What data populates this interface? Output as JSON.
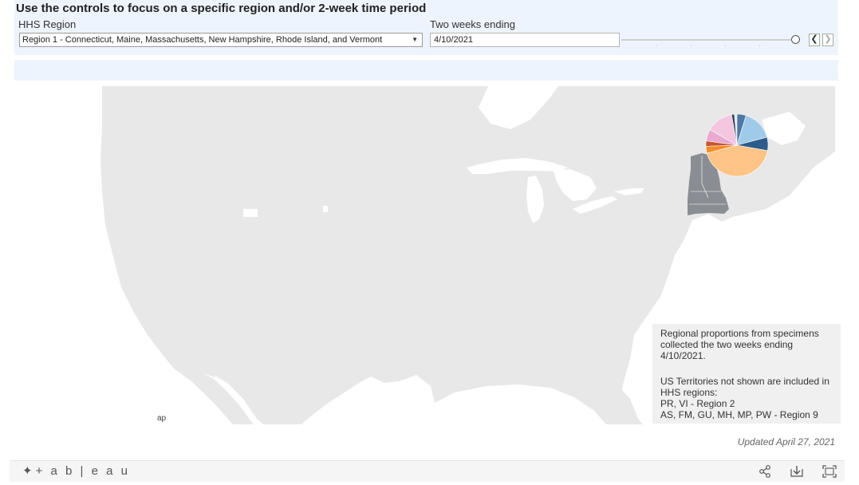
{
  "header": {
    "title": "Use the controls to focus on a specific region and/or 2-week time period"
  },
  "region_filter": {
    "label": "HHS Region",
    "selected": "Region 1 - Connecticut, Maine, Massachusetts, New Hampshire, Rhode Island, and Vermont"
  },
  "date_filter": {
    "label": "Two weeks ending",
    "value": "4/10/2021",
    "slider_position": 1.0
  },
  "map": {
    "background_color": "#e8e8e8",
    "highlight_color": "#8a8e94",
    "attribution_fragment": "ap",
    "pie_colors": [
      "#ffc486",
      "#f28e2b",
      "#c9552e",
      "#e8aad0",
      "#f4c6e0",
      "#1f3d5c",
      "#4e79a7",
      "#a0cbe8",
      "#2b5c8a"
    ]
  },
  "note": {
    "line1": "Regional proportions from specimens",
    "line2": "collected the two weeks ending",
    "line3": "4/10/2021.",
    "line4": "US Territories not shown are included in",
    "line5": "HHS regions:",
    "line6": "PR, VI - Region 2",
    "line7": "AS, FM, GU, MH, MP, PW - Region 9"
  },
  "updated": "Updated April 27, 2021",
  "footer": {
    "brand": "+ a b | e a u",
    "icons": [
      "share-icon",
      "download-icon",
      "fullscreen-icon"
    ]
  }
}
